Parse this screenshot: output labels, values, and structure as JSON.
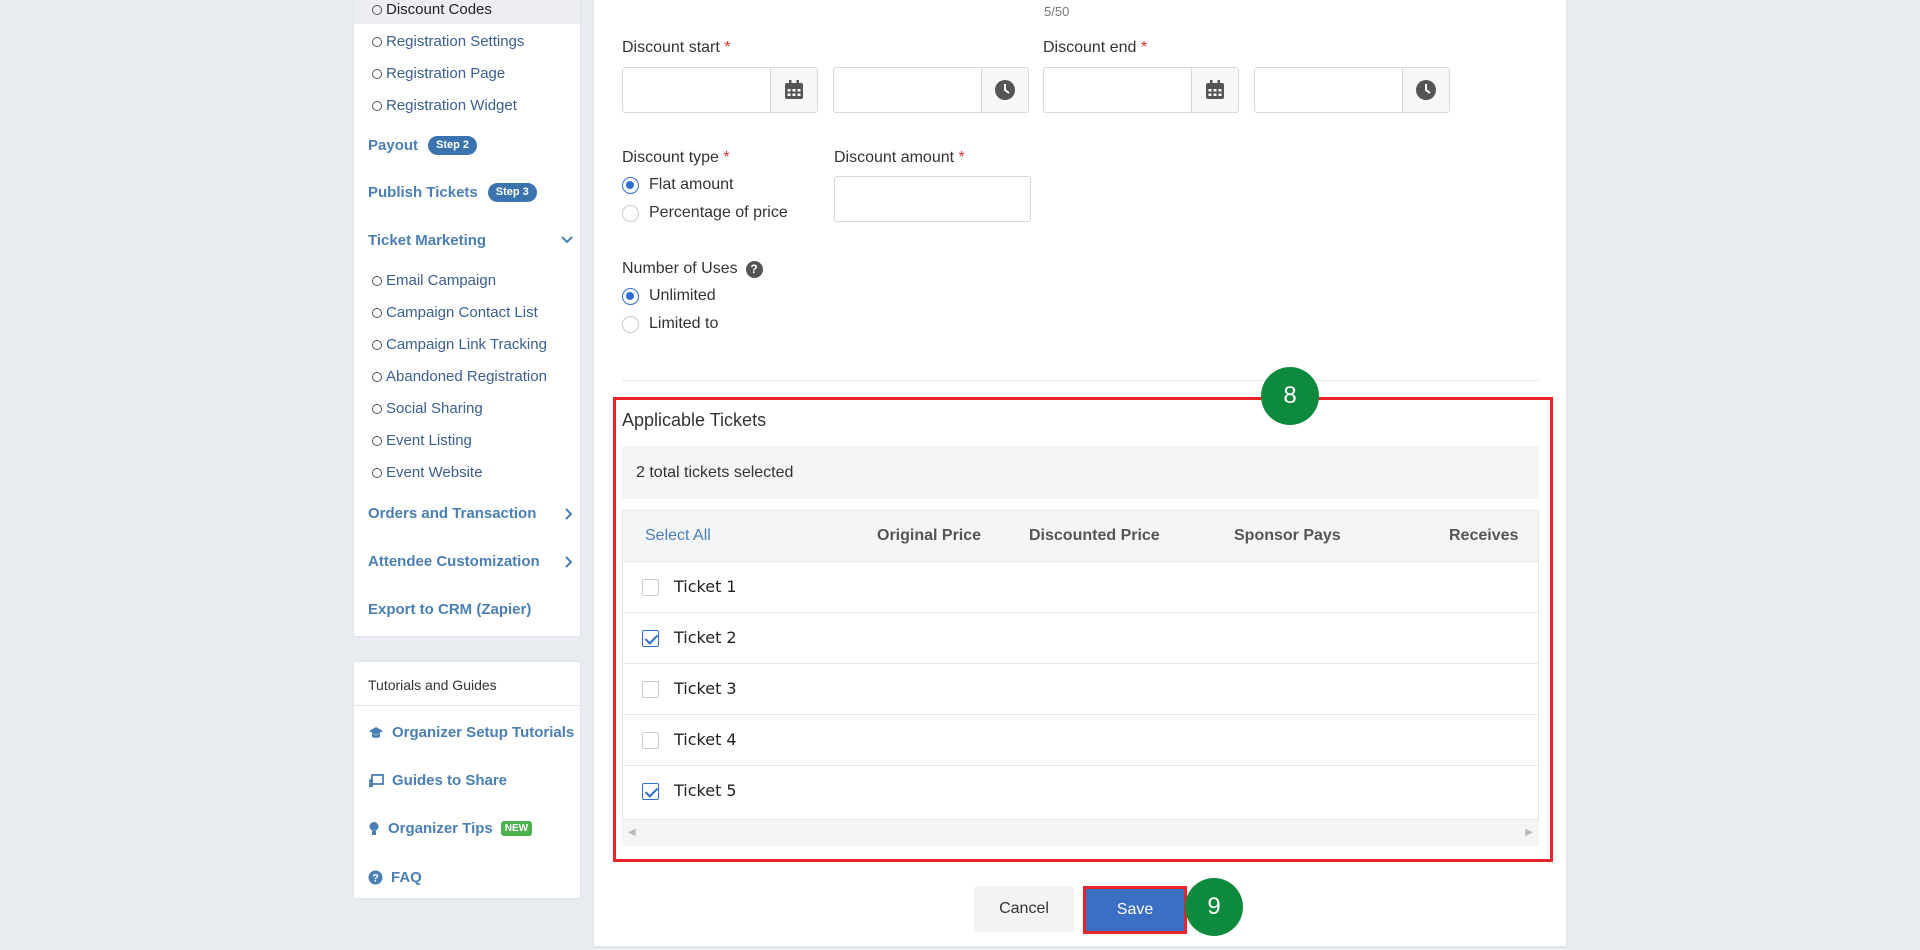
{
  "sidebar": {
    "sub_items_top": [
      {
        "label": "Discount Codes",
        "active": true
      },
      {
        "label": "Registration Settings"
      },
      {
        "label": "Registration Page"
      },
      {
        "label": "Registration Widget"
      }
    ],
    "payout": {
      "label": "Payout",
      "badge": "Step 2"
    },
    "publish": {
      "label": "Publish Tickets",
      "badge": "Step 3"
    },
    "ticket_marketing": {
      "label": "Ticket Marketing"
    },
    "marketing_items": [
      {
        "label": "Email Campaign"
      },
      {
        "label": "Campaign Contact List"
      },
      {
        "label": "Campaign Link Tracking"
      },
      {
        "label": "Abandoned Registration"
      },
      {
        "label": "Social Sharing"
      },
      {
        "label": "Event Listing"
      },
      {
        "label": "Event Website"
      }
    ],
    "orders": {
      "label": "Orders and Transaction"
    },
    "attendee": {
      "label": "Attendee Customization"
    },
    "export": {
      "label": "Export to CRM (Zapier)"
    }
  },
  "tutorials": {
    "title": "Tutorials and Guides",
    "items": [
      {
        "label": "Organizer Setup Tutorials",
        "icon": "graduation-cap-icon"
      },
      {
        "label": "Guides to Share",
        "icon": "presentation-icon"
      },
      {
        "label": "Organizer Tips",
        "icon": "lightbulb-icon",
        "badge": "NEW"
      },
      {
        "label": "FAQ",
        "icon": "question-circle-icon"
      }
    ]
  },
  "form": {
    "char_count": "5/50",
    "discount_start_label": "Discount start",
    "discount_end_label": "Discount end",
    "required_mark": "*",
    "discount_type_label": "Discount type",
    "discount_type_options": [
      "Flat amount",
      "Percentage of price"
    ],
    "discount_type_selected": "Flat amount",
    "discount_amount_label": "Discount amount",
    "uses_label": "Number of Uses",
    "uses_help": "?",
    "uses_options": [
      "Unlimited",
      "Limited to"
    ],
    "uses_selected": "Unlimited"
  },
  "tickets": {
    "title": "Applicable Tickets",
    "summary": "2 total tickets selected",
    "columns": [
      "Select All",
      "Original Price",
      "Discounted Price",
      "Sponsor Pays",
      "Receives"
    ],
    "rows": [
      {
        "name": "Ticket 1",
        "checked": false
      },
      {
        "name": "Ticket 2",
        "checked": true
      },
      {
        "name": "Ticket 3",
        "checked": false
      },
      {
        "name": "Ticket 4",
        "checked": false
      },
      {
        "name": "Ticket 5",
        "checked": true
      }
    ]
  },
  "actions": {
    "cancel": "Cancel",
    "save": "Save"
  },
  "markers": {
    "step8": "8",
    "step9": "9"
  },
  "colors": {
    "accent": "#4a7fb5",
    "highlight": "#e8232b",
    "marker": "#0e8a3e",
    "save": "#3b6fc4"
  }
}
